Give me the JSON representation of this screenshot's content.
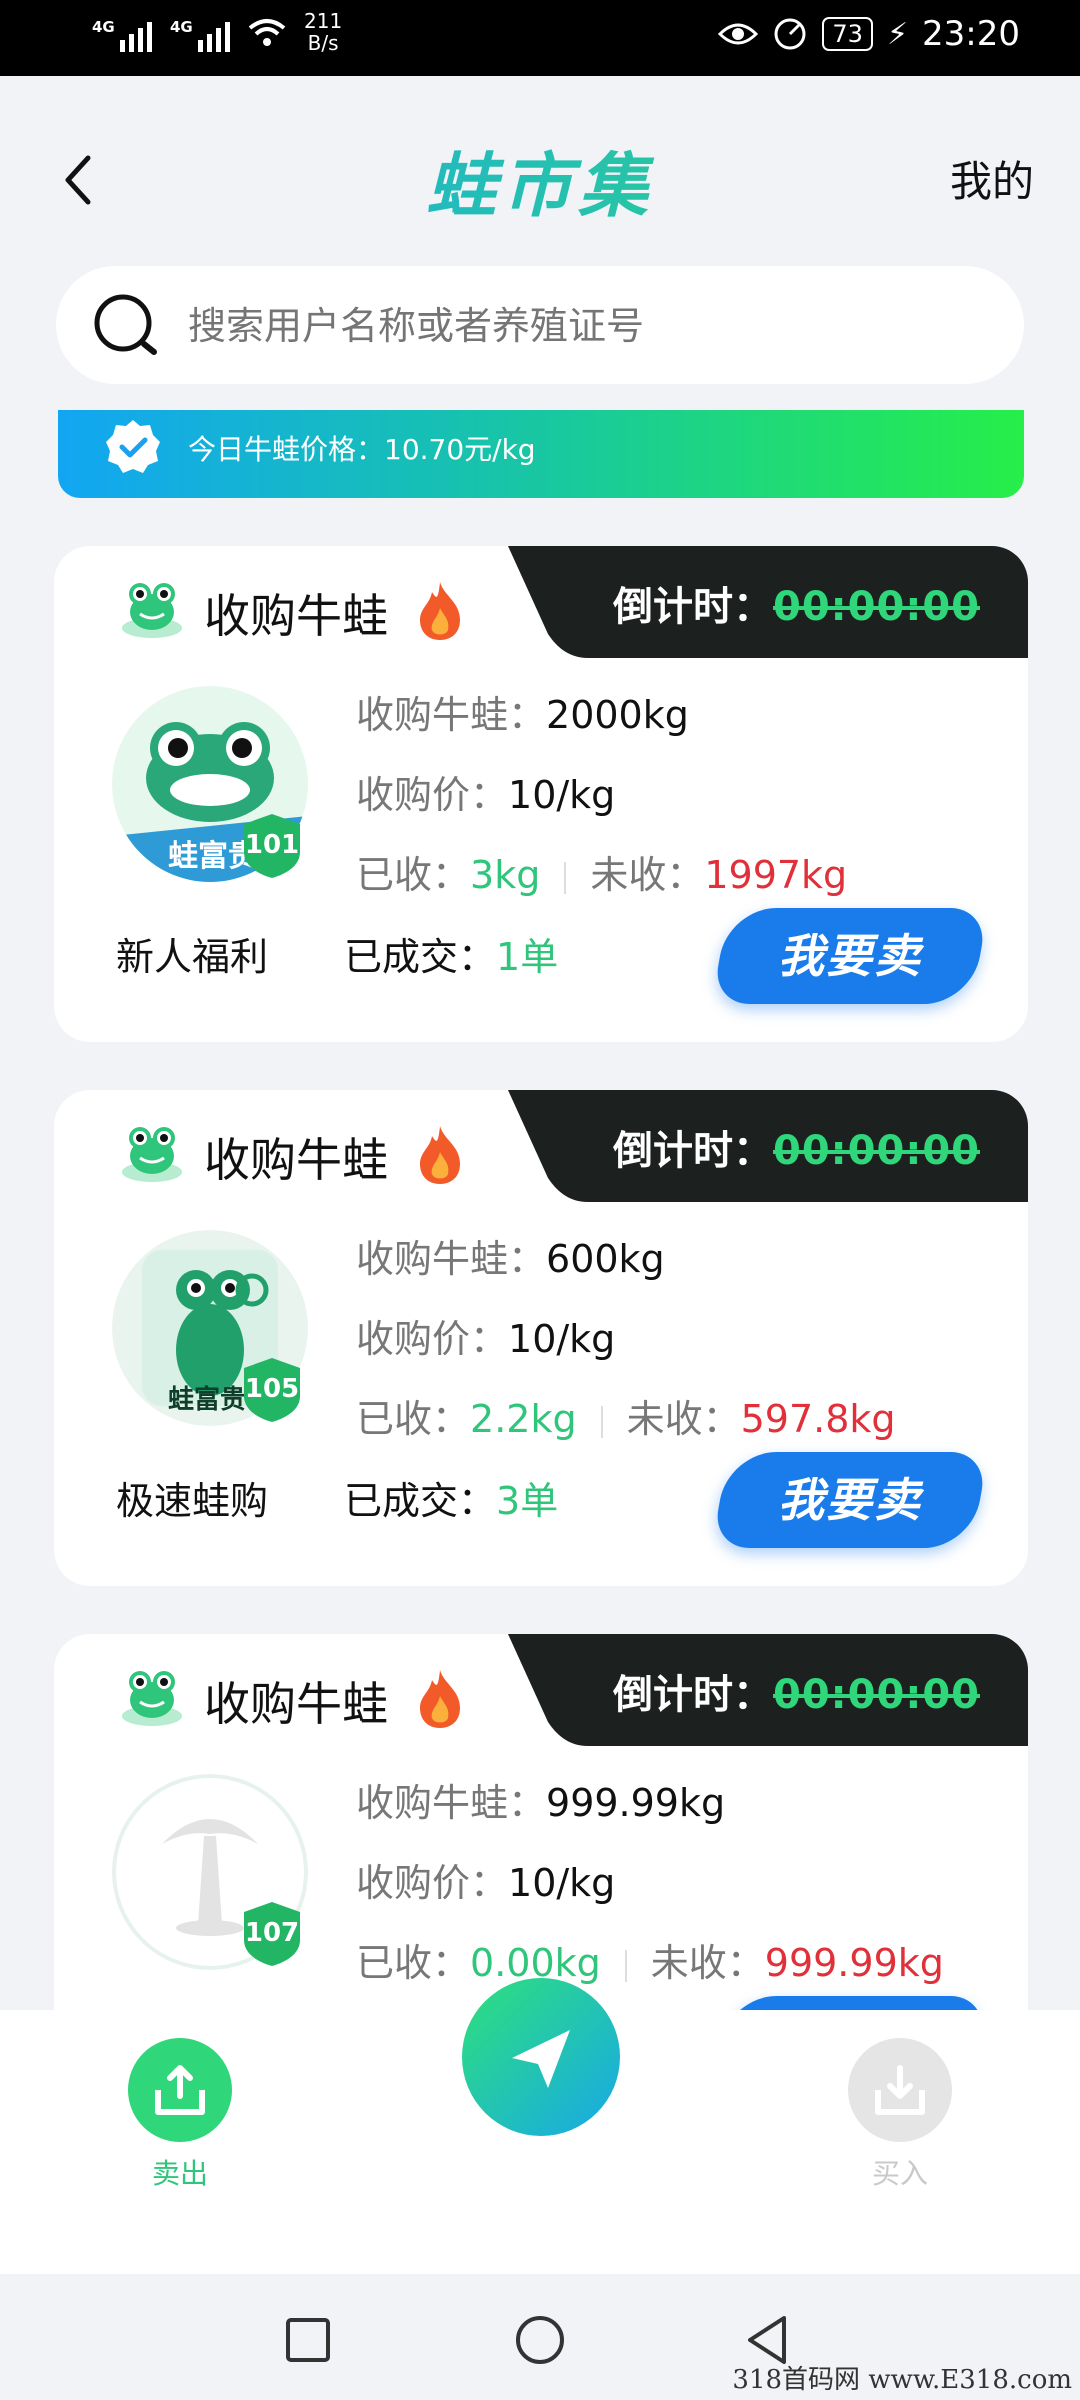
{
  "status_bar": {
    "net1": "4G",
    "net2": "4G",
    "speed": "211",
    "speed_unit": "B/s",
    "battery": "73",
    "time": "23:20"
  },
  "header": {
    "title": "蛙市集",
    "mine_label": "我的"
  },
  "search": {
    "placeholder": "搜索用户名称或者养殖证号"
  },
  "banner": {
    "text": "今日牛蛙价格：10.70元/kg"
  },
  "cards": [
    {
      "title": "收购牛蛙",
      "countdown_label": "倒计时：",
      "countdown_value": "00:00:00",
      "qty_label": "收购牛蛙：",
      "qty_value": "2000kg",
      "price_label": "收购价：",
      "price_value": "10/kg",
      "received_label": "已收：",
      "received_value": "3kg",
      "remaining_label": "未收：",
      "remaining_value": "1997kg",
      "avatar_text": "蛙富贵",
      "level": "101",
      "tag": "新人福利",
      "deals_label": "已成交：",
      "deals_value": "1单",
      "sell_label": "我要卖"
    },
    {
      "title": "收购牛蛙",
      "countdown_label": "倒计时：",
      "countdown_value": "00:00:00",
      "qty_label": "收购牛蛙：",
      "qty_value": "600kg",
      "price_label": "收购价：",
      "price_value": "10/kg",
      "received_label": "已收：",
      "received_value": "2.2kg",
      "remaining_label": "未收：",
      "remaining_value": "597.8kg",
      "avatar_text": "蛙富贵",
      "level": "105",
      "tag": "极速蛙购",
      "deals_label": "已成交：",
      "deals_value": "3单",
      "sell_label": "我要卖"
    },
    {
      "title": "收购牛蛙",
      "countdown_label": "倒计时：",
      "countdown_value": "00:00:00",
      "qty_label": "收购牛蛙：",
      "qty_value": "999.99kg",
      "price_label": "收购价：",
      "price_value": "10/kg",
      "received_label": "已收：",
      "received_value": "0.00kg",
      "remaining_label": "未收：",
      "remaining_value": "999.99kg",
      "level": "107"
    }
  ],
  "bottom_nav": {
    "sell_label": "卖出",
    "buy_label": "买入"
  },
  "watermark": "318首码网 www.E318.com",
  "colors": {
    "accent_green": "#2fc57a",
    "accent_blue": "#1a7bea",
    "remaining_red": "#e0303a",
    "countdown_bg": "#1c201f"
  }
}
